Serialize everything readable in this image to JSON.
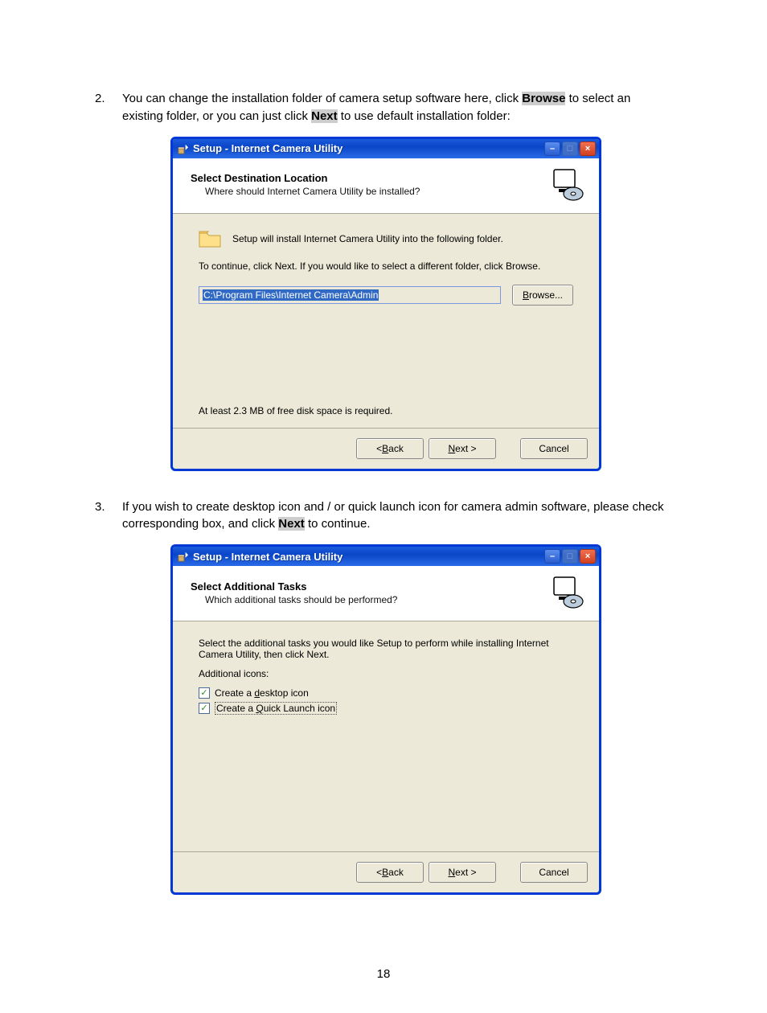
{
  "steps": {
    "s2": {
      "num": "2.",
      "text_pre": "You can change the installation folder of camera setup software here, click ",
      "browse": "Browse",
      "text_mid": " to select an existing folder, or you can just click ",
      "next": "Next",
      "text_end": " to use default installation folder:"
    },
    "s3": {
      "num": "3.",
      "text_pre": "If you wish to create desktop icon and / or quick launch icon for camera admin software, please check corresponding box, and click ",
      "next": "Next",
      "text_end": " to continue."
    }
  },
  "dlg1": {
    "title": "Setup - Internet Camera Utility",
    "header_title": "Select Destination Location",
    "header_sub": "Where should Internet Camera Utility be installed?",
    "line1": "Setup will install Internet Camera Utility into the following folder.",
    "line2": "To continue, click Next. If you would like to select a different folder, click Browse.",
    "path": "C:\\Program Files\\Internet Camera\\Admin",
    "browse_pre": "B",
    "browse_txt": "rowse...",
    "disk": "At least 2.3 MB of free disk space is required.",
    "back_pre": "< ",
    "back_u": "B",
    "back_post": "ack",
    "next_u": "N",
    "next_post": "ext >",
    "cancel": "Cancel"
  },
  "dlg2": {
    "title": "Setup - Internet Camera Utility",
    "header_title": "Select Additional Tasks",
    "header_sub": "Which additional tasks should be performed?",
    "line1": "Select the additional tasks you would like Setup to perform while installing Internet Camera Utility, then click Next.",
    "group": "Additional icons:",
    "opt1_pre": "Create a ",
    "opt1_u": "d",
    "opt1_post": "esktop icon",
    "opt2_pre": "Create a ",
    "opt2_u": "Q",
    "opt2_post": "uick Launch icon",
    "back_pre": "< ",
    "back_u": "B",
    "back_post": "ack",
    "next_u": "N",
    "next_post": "ext >",
    "cancel": "Cancel"
  },
  "page_number": "18"
}
